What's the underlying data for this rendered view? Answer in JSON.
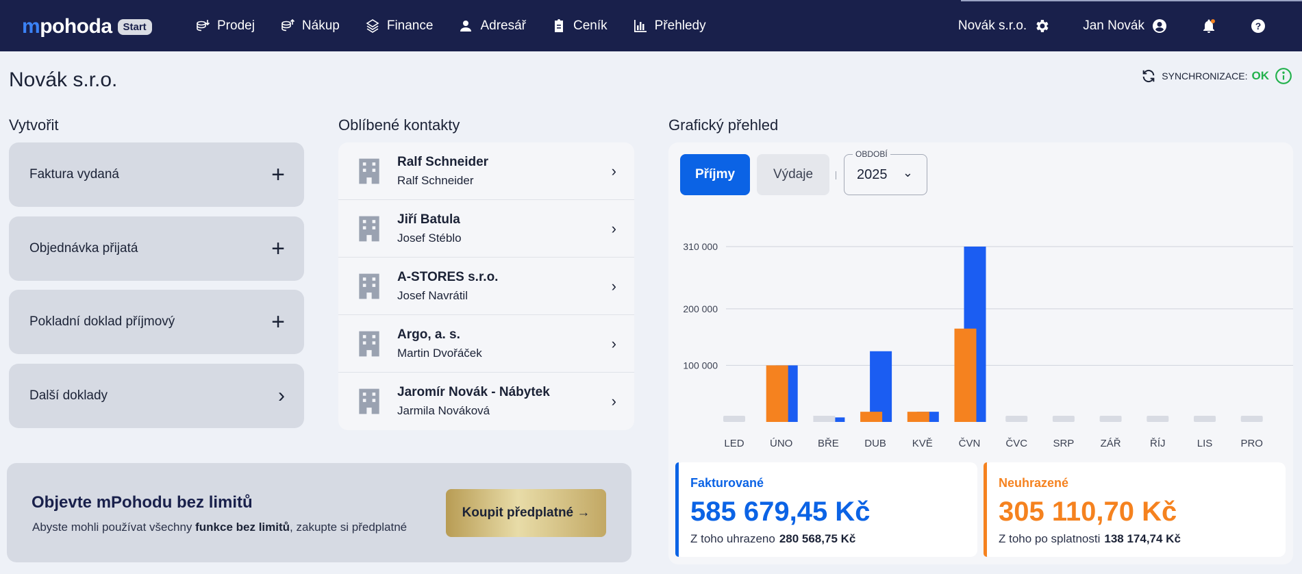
{
  "app": {
    "logo_m": "m",
    "logo_rest": "pohoda",
    "badge": "Start"
  },
  "nav": [
    {
      "label": "Prodej",
      "icon": "coins-down-icon"
    },
    {
      "label": "Nákup",
      "icon": "coins-up-icon"
    },
    {
      "label": "Finance",
      "icon": "finance-icon"
    },
    {
      "label": "Adresář",
      "icon": "person-icon"
    },
    {
      "label": "Ceník",
      "icon": "price-list-icon"
    },
    {
      "label": "Přehledy",
      "icon": "bar-chart-icon"
    }
  ],
  "top_right": {
    "company": "Novák s.r.o.",
    "user": "Jan Novák"
  },
  "page": {
    "title": "Novák s.r.o."
  },
  "sync": {
    "label": "SYNCHRONIZACE:",
    "status": "OK"
  },
  "create": {
    "title": "Vytvořit",
    "items": [
      {
        "label": "Faktura vydaná",
        "icon": "+"
      },
      {
        "label": "Objednávka přijatá",
        "icon": "+"
      },
      {
        "label": "Pokladní doklad příjmový",
        "icon": "+"
      },
      {
        "label": "Další doklady",
        "icon": "›"
      }
    ]
  },
  "contacts": {
    "title": "Oblíbené kontakty",
    "items": [
      {
        "name": "Ralf Schneider",
        "person": "Ralf Schneider"
      },
      {
        "name": "Jiří Batula",
        "person": "Josef Stéblo"
      },
      {
        "name": "A-STORES s.r.o.",
        "person": "Josef Navrátil"
      },
      {
        "name": "Argo, a. s.",
        "person": "Martin Dvořáček"
      },
      {
        "name": "Jaromír Novák - Nábytek",
        "person": "Jarmila Nováková"
      }
    ]
  },
  "promo": {
    "title": "Objevte mPohodu bez limitů",
    "sub_prefix": "Abyste mohli používat všechny ",
    "sub_bold": "funkce bez limitů",
    "sub_suffix": ", zakupte si předplatné",
    "button": "Koupit předplatné →"
  },
  "chart_panel": {
    "title": "Grafický přehled",
    "tab_income": "Příjmy",
    "tab_expenses": "Výdaje",
    "period_label": "OBDOBÍ",
    "period_value": "2025"
  },
  "chart_data": {
    "type": "bar",
    "categories": [
      "LED",
      "ÚNO",
      "BŘE",
      "DUB",
      "KVĚ",
      "ČVN",
      "ČVC",
      "SRP",
      "ZÁŘ",
      "ŘÍJ",
      "LIS",
      "PRO"
    ],
    "series": [
      {
        "color": "#f5821f",
        "values": [
          0,
          100000,
          0,
          18000,
          18000,
          165000,
          0,
          0,
          0,
          0,
          0,
          0
        ]
      },
      {
        "color": "#1b5df2",
        "values": [
          0,
          100000,
          8000,
          125000,
          18000,
          310000,
          0,
          0,
          0,
          0,
          0,
          0
        ]
      }
    ],
    "yticks": [
      100000,
      200000,
      310000
    ],
    "ytick_labels": [
      "100 000",
      "200 000",
      "310 000"
    ],
    "ylim": [
      0,
      310000
    ],
    "grid": true,
    "empty_color": "#d8dbe3"
  },
  "summary": {
    "invoiced": {
      "label": "Fakturované",
      "amount": "585 679,45 Kč",
      "foot_label": "Z toho uhrazeno",
      "foot_value": "280 568,75 Kč",
      "color": "#0b63e5"
    },
    "unpaid": {
      "label": "Neuhrazené",
      "amount": "305 110,70 Kč",
      "foot_label": "Z toho po splatnosti",
      "foot_value": "138 174,74 Kč",
      "color": "#f5821f"
    }
  }
}
